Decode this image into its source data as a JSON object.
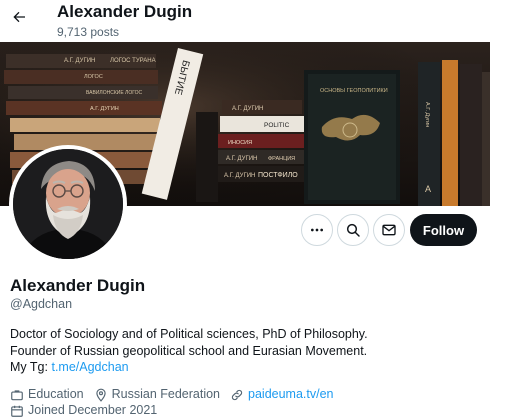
{
  "header": {
    "name": "Alexander Dugin",
    "post_count": "9,713 posts"
  },
  "banner": {
    "book_spines": [
      "А.Г. ДУГИН",
      "ЛОГОС ТУРАНА",
      "ЛОГОС",
      "ВАВИЛОНСКИЕ ЛОГОС",
      "А.Г. ДУГИН",
      "БЫТИЕ",
      "А.Г. ДУГИН",
      "POLITIC",
      "ИНОСИЯ",
      "А.Г. ДУГИН",
      "ФРАНЦИЯ",
      "А.Г. ДУГИН",
      "ПОСТФИЛО",
      "ОСНОВЫ ГЕОПОЛИТИКИ",
      "А.Г. Дугин",
      "А"
    ]
  },
  "actions": {
    "follow_label": "Follow"
  },
  "profile": {
    "name": "Alexander Dugin",
    "handle": "@Agdchan",
    "bio_line1": "Doctor of Sociology and of Political sciences, PhD of Philosophy.",
    "bio_line2": "Founder of Russian geopolitical school and Eurasian Movement.",
    "bio_line3_prefix": "My Tg:",
    "bio_link": "t.me/Agdchan",
    "category": "Education",
    "location": "Russian Federation",
    "website": "paideuma.tv/en",
    "joined": "Joined December 2021"
  },
  "icons": {
    "back": "arrow-left-icon",
    "more": "more-horizontal-icon",
    "search": "search-icon",
    "message": "envelope-icon",
    "category": "briefcase-icon",
    "location": "map-pin-icon",
    "website": "link-icon",
    "joined": "calendar-icon"
  },
  "colors": {
    "text": "#0f1419",
    "secondary": "#536471",
    "link": "#1d9bf0",
    "follow_bg": "#0f1419",
    "border": "#cfd9de"
  }
}
